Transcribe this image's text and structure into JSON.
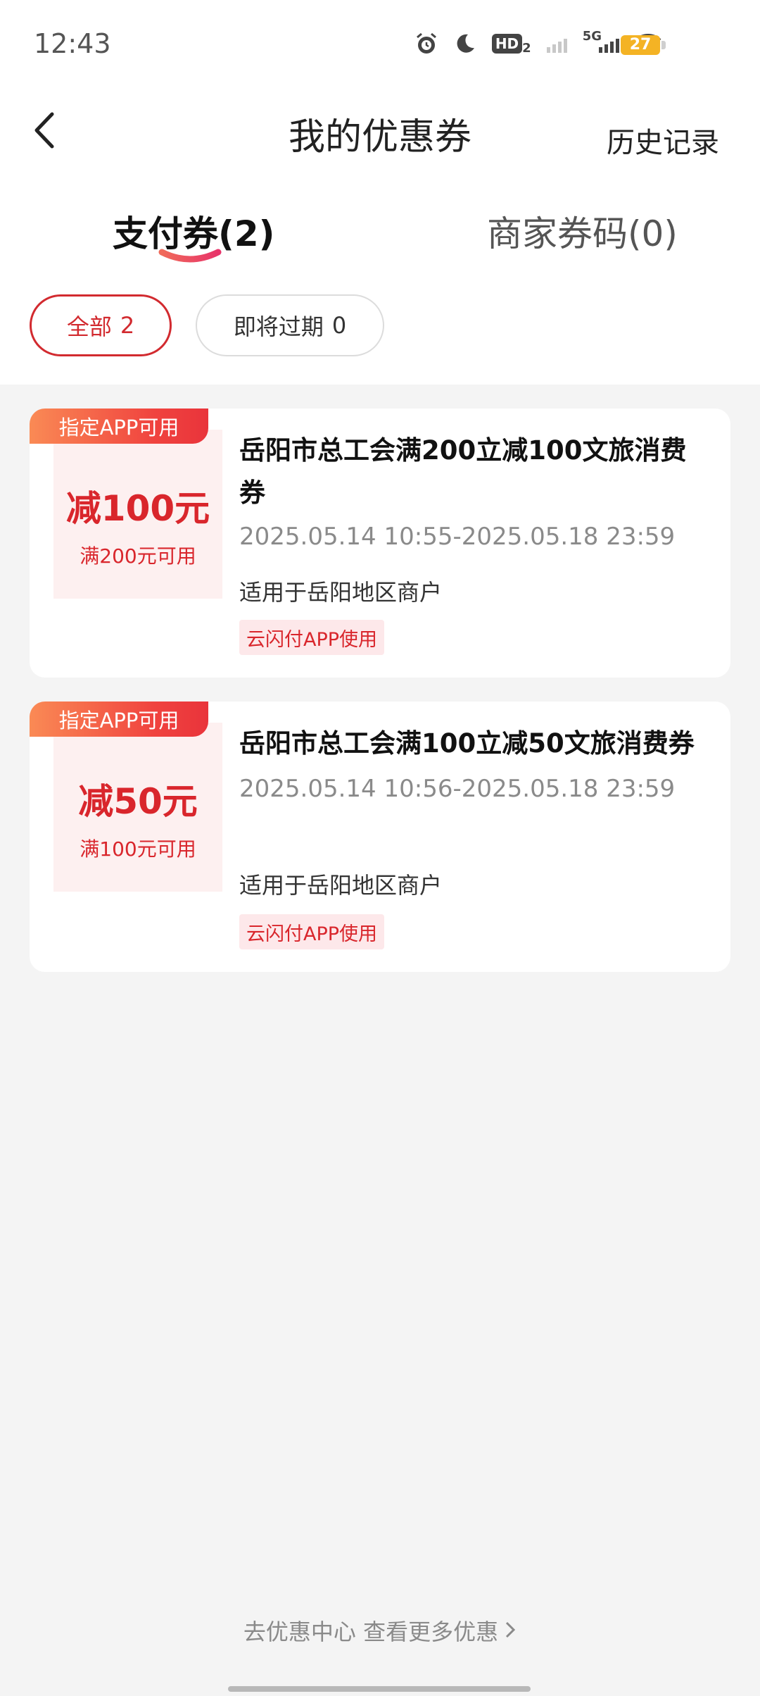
{
  "status_bar": {
    "time": "12:43",
    "hd_label": "HD",
    "hd_sub": "2",
    "network": "5G",
    "battery": "27"
  },
  "header": {
    "title": "我的优惠券",
    "history_label": "历史记录"
  },
  "tabs": [
    {
      "label": "支付券",
      "count": "(2)",
      "active": true
    },
    {
      "label": "商家券码(0)",
      "active": false
    }
  ],
  "filters": [
    {
      "label": "全部",
      "count": "2",
      "active": true
    },
    {
      "label": "即将过期",
      "count": "0",
      "active": false
    }
  ],
  "coupons": [
    {
      "badge": "指定APP可用",
      "amount": "减100元",
      "condition": "满200元可用",
      "title_line1": "岳阳市总工会满200立减100文旅消费",
      "title_line2": "券",
      "period": "2025.05.14 10:55-2025.05.18 23:59",
      "scope": "适用于岳阳地区商户",
      "tag": "云闪付APP使用"
    },
    {
      "badge": "指定APP可用",
      "amount": "减50元",
      "condition": "满100元可用",
      "title": "岳阳市总工会满100立减50文旅消费券",
      "period": "2025.05.14 10:56-2025.05.18 23:59",
      "scope": "适用于岳阳地区商户",
      "tag": "云闪付APP使用"
    }
  ],
  "footer": {
    "more_link": "去优惠中心 查看更多优惠"
  },
  "colors": {
    "accent": "#d9262c",
    "badge_gradient_start": "#fa8a55",
    "badge_gradient_end": "#e9343b",
    "background": "#f4f4f4"
  }
}
